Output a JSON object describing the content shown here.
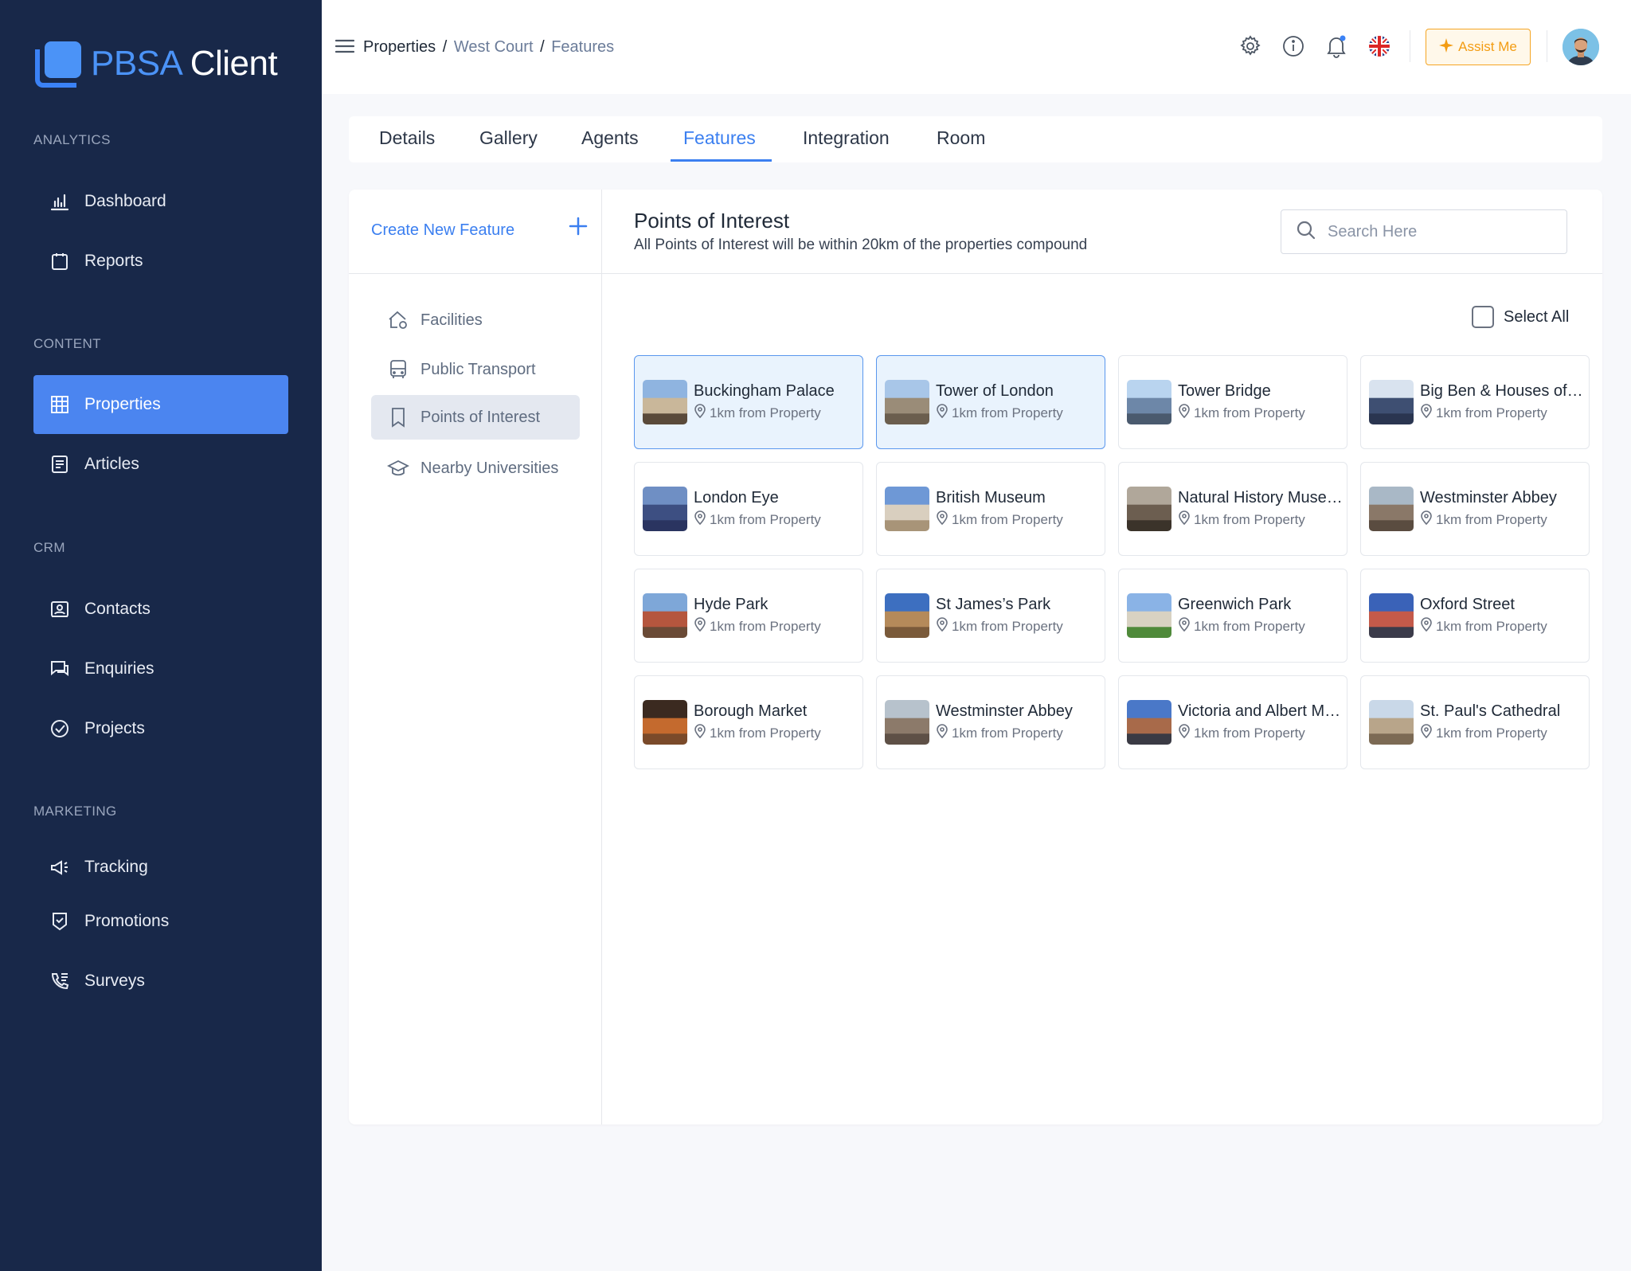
{
  "app": {
    "name_part1": "PBSA",
    "name_part2": "Client"
  },
  "sidebar": {
    "sections": [
      {
        "label": "ANALYTICS"
      },
      {
        "label": "CONTENT"
      },
      {
        "label": "CRM"
      },
      {
        "label": "MARKETING"
      }
    ],
    "items": [
      {
        "label": "Dashboard",
        "icon": "bar-chart-icon"
      },
      {
        "label": "Reports",
        "icon": "clipboard-icon"
      },
      {
        "label": "Properties",
        "icon": "building-icon",
        "active": true
      },
      {
        "label": "Articles",
        "icon": "document-icon"
      },
      {
        "label": "Contacts",
        "icon": "contact-card-icon"
      },
      {
        "label": "Enquiries",
        "icon": "chat-icon"
      },
      {
        "label": "Projects",
        "icon": "check-circle-icon"
      },
      {
        "label": "Tracking",
        "icon": "megaphone-icon"
      },
      {
        "label": "Promotions",
        "icon": "badge-icon"
      },
      {
        "label": "Surveys",
        "icon": "phone-list-icon"
      }
    ]
  },
  "header": {
    "breadcrumb": [
      "Properties",
      "West Court",
      "Features"
    ],
    "separator": "/",
    "assist_label": "Assist Me",
    "icons": [
      "gear-icon",
      "info-icon",
      "bell-icon",
      "uk-flag-icon"
    ]
  },
  "tabs": [
    {
      "label": "Details"
    },
    {
      "label": "Gallery"
    },
    {
      "label": "Agents"
    },
    {
      "label": "Features",
      "active": true
    },
    {
      "label": "Integration"
    },
    {
      "label": "Room"
    }
  ],
  "features_panel": {
    "create_label": "Create New Feature",
    "categories": [
      {
        "label": "Facilities",
        "icon": "house-gear-icon"
      },
      {
        "label": "Public Transport",
        "icon": "bus-icon"
      },
      {
        "label": "Points of Interest",
        "icon": "bookmark-icon",
        "active": true
      },
      {
        "label": "Nearby Universities",
        "icon": "graduation-cap-icon"
      }
    ]
  },
  "poi_section": {
    "title": "Points of Interest",
    "subtitle": "All Points of Interest will be within 20km of the properties compound",
    "search_placeholder": "Search Here",
    "select_all_label": "Select All",
    "items": [
      {
        "name": "Buckingham Palace",
        "distance": "1km from Property",
        "selected": true,
        "colors": [
          "#8fb4e0",
          "#c9b79a",
          "#5a4a3a"
        ]
      },
      {
        "name": "Tower of London",
        "distance": "1km from Property",
        "selected": true,
        "colors": [
          "#a8c6e8",
          "#9a8c78",
          "#6b5e4e"
        ]
      },
      {
        "name": "Tower Bridge",
        "distance": "1km from Property",
        "selected": false,
        "colors": [
          "#b9d4ef",
          "#6d87a8",
          "#4a5a6e"
        ]
      },
      {
        "name": "Big Ben & Houses of Parliament",
        "distance": "1km from Property",
        "selected": false,
        "colors": [
          "#d9e3ef",
          "#3e4f72",
          "#2a3550"
        ]
      },
      {
        "name": "London Eye",
        "distance": "1km from Property",
        "selected": false,
        "colors": [
          "#6f8fc4",
          "#3d4f82",
          "#2a3460"
        ]
      },
      {
        "name": "British Museum",
        "distance": "1km from Property",
        "selected": false,
        "colors": [
          "#6e98d6",
          "#d9cfbf",
          "#a89478"
        ]
      },
      {
        "name": "Natural History Museum",
        "distance": "1km from Property",
        "selected": false,
        "colors": [
          "#b0a79a",
          "#6c5e50",
          "#3b332a"
        ]
      },
      {
        "name": "Westminster Abbey",
        "distance": "1km from Property",
        "selected": false,
        "colors": [
          "#a9b8c6",
          "#8a7868",
          "#5a4c40"
        ]
      },
      {
        "name": "Hyde Park",
        "distance": "1km from Property",
        "selected": false,
        "colors": [
          "#7ea7d8",
          "#b5563e",
          "#6a4a36"
        ]
      },
      {
        "name": "St James’s Park",
        "distance": "1km from Property",
        "selected": false,
        "colors": [
          "#3d6fc0",
          "#b58a5a",
          "#7a5a3a"
        ]
      },
      {
        "name": "Greenwich Park",
        "distance": "1km from Property",
        "selected": false,
        "colors": [
          "#8ab3e6",
          "#d8d2c2",
          "#4f8a3a"
        ]
      },
      {
        "name": "Oxford Street",
        "distance": "1km from Property",
        "selected": false,
        "colors": [
          "#3a62b8",
          "#c45a4a",
          "#3b3b4a"
        ]
      },
      {
        "name": "Borough Market",
        "distance": "1km from Property",
        "selected": false,
        "colors": [
          "#3b2a20",
          "#c46a2e",
          "#7a4a2a"
        ]
      },
      {
        "name": "Westminster Abbey",
        "distance": "1km from Property",
        "selected": false,
        "colors": [
          "#b7c2cc",
          "#8c7a6a",
          "#5e5046"
        ]
      },
      {
        "name": "Victoria and Albert Museum",
        "distance": "1km from Property",
        "selected": false,
        "colors": [
          "#4a78c8",
          "#a86a4a",
          "#3a3a44"
        ]
      },
      {
        "name": "St. Paul's Cathedral",
        "distance": "1km from Property",
        "selected": false,
        "colors": [
          "#c9d8e8",
          "#b8a58a",
          "#7c6a54"
        ]
      }
    ]
  },
  "colors": {
    "sidebar_bg": "#182849",
    "accent": "#3b7ff0",
    "assist": "#f39c12"
  }
}
